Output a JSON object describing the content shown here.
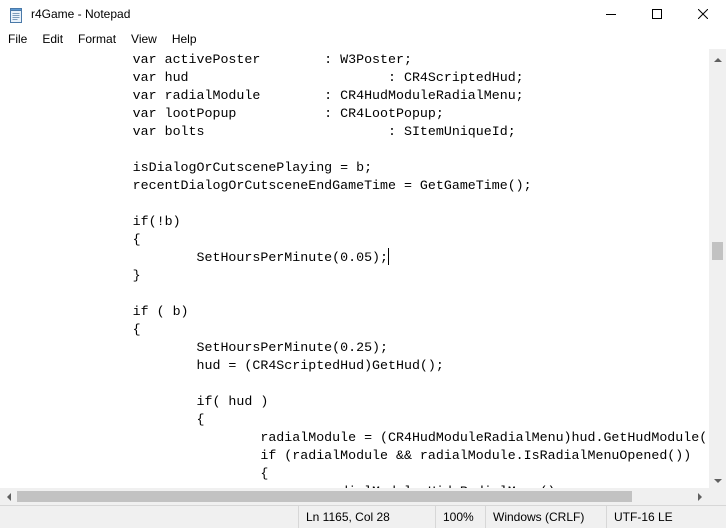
{
  "window": {
    "title": "r4Game - Notepad",
    "icons": {
      "app": "notepad-icon",
      "minimize": "minimize-icon",
      "maximize": "maximize-icon",
      "close": "close-icon"
    }
  },
  "menu": [
    {
      "label": "File"
    },
    {
      "label": "Edit"
    },
    {
      "label": "Format"
    },
    {
      "label": "View"
    },
    {
      "label": "Help"
    }
  ],
  "editor": {
    "lines": [
      "                var activePoster        : W3Poster;",
      "                var hud                         : CR4ScriptedHud;",
      "                var radialModule        : CR4HudModuleRadialMenu;",
      "                var lootPopup           : CR4LootPopup;",
      "                var bolts                       : SItemUniqueId;",
      "",
      "                isDialogOrCutscenePlaying = b;",
      "                recentDialogOrCutsceneEndGameTime = GetGameTime();",
      "",
      "                if(!b)",
      "                {",
      "                        SetHoursPerMinute(0.05);",
      "                }",
      "",
      "                if ( b)",
      "                {",
      "                        SetHoursPerMinute(0.25);",
      "                        hud = (CR4ScriptedHud)GetHud();",
      "",
      "                        if( hud )",
      "                        {",
      "                                radialModule = (CR4HudModuleRadialMenu)hud.GetHudModule(",
      "                                if (radialModule && radialModule.IsRadialMenuOpened())",
      "                                {",
      "                                        radialModule.HideRadialMenu();"
    ]
  },
  "status": {
    "position": "Ln 1165, Col 28",
    "zoom": "100%",
    "line_ending": "Windows (CRLF)",
    "encoding": "UTF-16 LE"
  }
}
